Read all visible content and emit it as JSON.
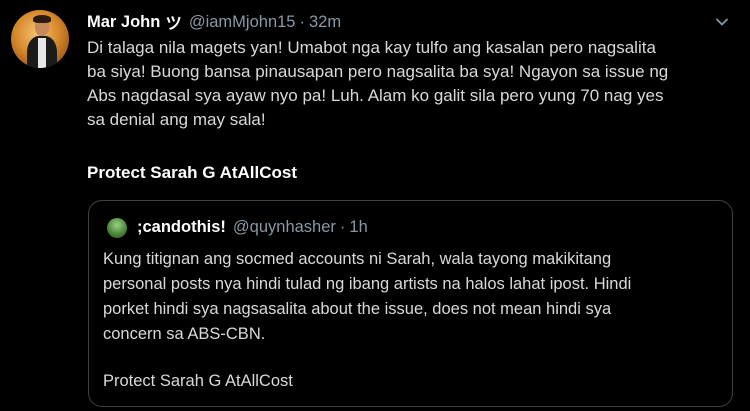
{
  "tweet": {
    "author_name": "Mar John",
    "author_symbol": "ツ",
    "handle": "@iamMjohn15",
    "separator": "·",
    "time": "32m",
    "text": "Di talaga nila magets yan! Umabot nga kay tulfo ang kasalan pero nagsalita\nba siya! Buong bansa pinausapan pero nagsalita ba sya! Ngayon sa issue ng\nAbs nagdasal sya ayaw nyo pa! Luh. Alam ko galit sila pero yung 70 nag yes\nsa denial ang may sala!",
    "signature": "Protect Sarah G AtAllCost",
    "menu_icon": "chevron-down-icon"
  },
  "quoted_tweet": {
    "author_name": ";candothis!",
    "handle": "@quynhasher",
    "separator": "·",
    "time": "1h",
    "text": "Kung titignan ang socmed accounts ni Sarah, wala tayong makikitang\npersonal posts nya hindi tulad ng ibang artists na halos lahat ipost. Hindi\nporket hindi sya nagsasalita about the issue, does not mean hindi sya\nconcern sa ABS-CBN.",
    "signature": "Protect Sarah G AtAllCost"
  },
  "colors": {
    "background": "#000000",
    "text": "#d9d9d9",
    "secondary": "#8899a6",
    "border": "#3d4247"
  }
}
